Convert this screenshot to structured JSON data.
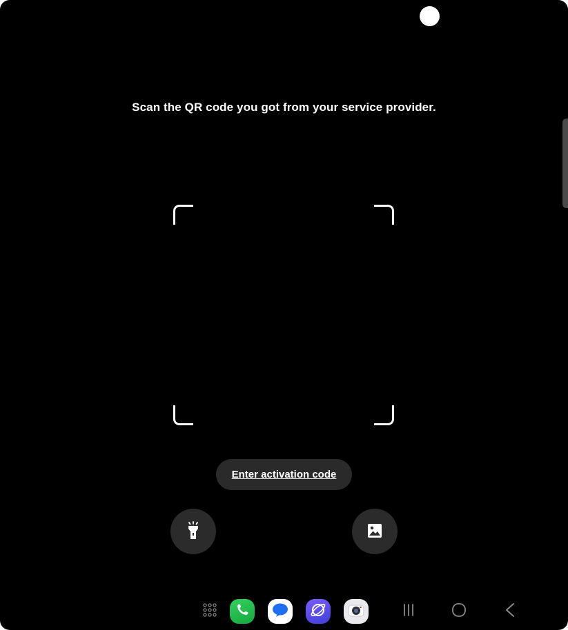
{
  "instruction_text": "Scan the QR code you got from your service provider.",
  "activation_button_label": "Enter activation code",
  "icons": {
    "flashlight": "flashlight-icon",
    "gallery": "image-gallery-icon",
    "apps": "app-grid-icon",
    "phone": "phone-icon",
    "messages": "messages-icon",
    "internet": "internet-icon",
    "camera": "camera-icon",
    "recents": "recent-apps-icon",
    "home": "home-icon",
    "back": "back-icon"
  },
  "colors": {
    "background": "#000000",
    "button_bg": "#2a2a2a",
    "text": "#ffffff"
  }
}
